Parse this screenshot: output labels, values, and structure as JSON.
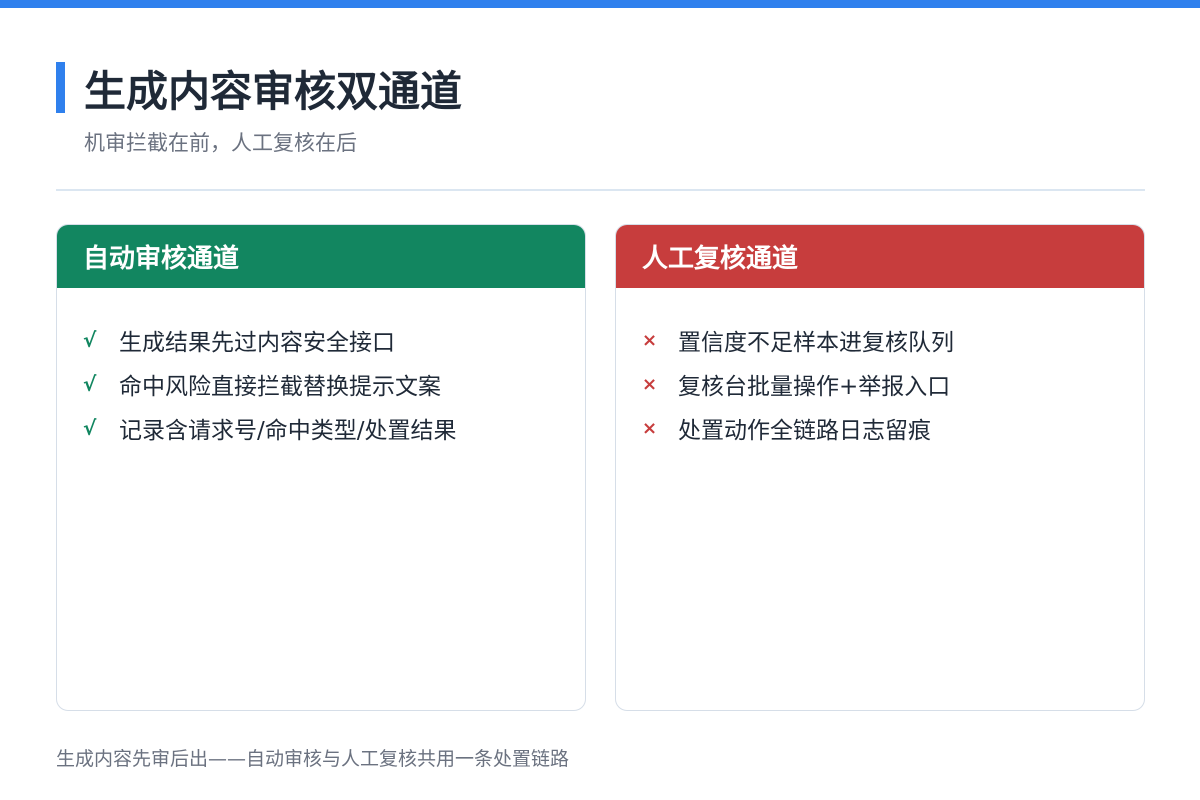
{
  "header": {
    "title": "生成内容审核双通道",
    "subtitle": "机审拦截在前，人工复核在后"
  },
  "auto_channel": {
    "title": "自动审核通道",
    "mark": "√",
    "items": [
      "生成结果先过内容安全接口",
      "命中风险直接拦截替换提示文案",
      "记录含请求号/命中类型/处置结果"
    ]
  },
  "manual_channel": {
    "title": "人工复核通道",
    "mark": "×",
    "items": [
      "置信度不足样本进复核队列",
      "复核台批量操作+举报入口",
      "处置动作全链路日志留痕"
    ]
  },
  "footer": {
    "note": "生成内容先审后出——自动审核与人工复核共用一条处置链路"
  },
  "colors": {
    "accent": "#2f80ed",
    "auto_header": "#128660",
    "manual_header": "#c73d3d"
  }
}
